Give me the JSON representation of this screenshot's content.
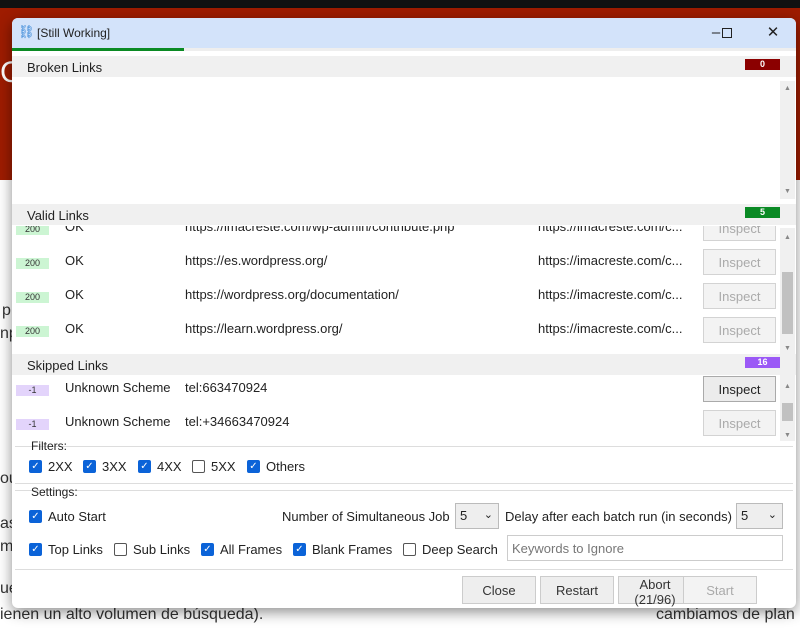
{
  "background": {
    "fragments": [
      "C",
      "p",
      "np",
      "ou",
      "as",
      "m",
      "ue",
      "ienen un alto volumen de búsqueda).",
      "cambiamos de plan"
    ]
  },
  "window": {
    "title": "[Still Working]",
    "icon": "broken-link-icon",
    "progress_percent": 21.9,
    "progress_color": "#0a8a24",
    "controls": [
      "minimize",
      "maximize",
      "close"
    ]
  },
  "broken": {
    "label": "Broken Links",
    "count": "0",
    "color": "#8b0000",
    "rows": []
  },
  "valid": {
    "label": "Valid Links",
    "count": "5",
    "color": "#0a8a24",
    "code_bg": "#ccf5d3",
    "rows": [
      {
        "code": "200",
        "status": "OK",
        "url": "https://imacreste.com/wp-admin/contribute.php",
        "source": "https://imacreste.com/c...",
        "action": "Inspect"
      },
      {
        "code": "200",
        "status": "OK",
        "url": "https://es.wordpress.org/",
        "source": "https://imacreste.com/c...",
        "action": "Inspect"
      },
      {
        "code": "200",
        "status": "OK",
        "url": "https://wordpress.org/documentation/",
        "source": "https://imacreste.com/c...",
        "action": "Inspect"
      },
      {
        "code": "200",
        "status": "OK",
        "url": "https://learn.wordpress.org/",
        "source": "https://imacreste.com/c...",
        "action": "Inspect"
      }
    ]
  },
  "skipped": {
    "label": "Skipped Links",
    "count": "16",
    "color": "#9b59f6",
    "code_bg": "#e3d4fb",
    "rows": [
      {
        "code": "-1",
        "status": "Unknown Scheme",
        "url": "tel:663470924",
        "source": "",
        "action": "Inspect"
      },
      {
        "code": "-1",
        "status": "Unknown Scheme",
        "url": "tel:+34663470924",
        "source": "",
        "action": "Inspect"
      }
    ]
  },
  "filters": {
    "label": "Filters:",
    "items": [
      {
        "label": "2XX",
        "checked": true
      },
      {
        "label": "3XX",
        "checked": true
      },
      {
        "label": "4XX",
        "checked": true
      },
      {
        "label": "5XX",
        "checked": false
      },
      {
        "label": "Others",
        "checked": true
      }
    ]
  },
  "settings": {
    "label": "Settings:",
    "auto_start": {
      "label": "Auto Start",
      "checked": true
    },
    "jobs_label": "Number of Simultaneous Job",
    "jobs_value": "5",
    "delay_label": "Delay after each batch run (in seconds)",
    "delay_value": "5",
    "options": [
      {
        "label": "Top Links",
        "checked": true
      },
      {
        "label": "Sub Links",
        "checked": false
      },
      {
        "label": "All Frames",
        "checked": true
      },
      {
        "label": "Blank Frames",
        "checked": true
      },
      {
        "label": "Deep Search",
        "checked": false
      }
    ],
    "keywords_placeholder": "Keywords to Ignore",
    "keywords_value": ""
  },
  "buttons": {
    "close": "Close",
    "restart": "Restart",
    "abort": "Abort (21/96)",
    "start": "Start"
  }
}
